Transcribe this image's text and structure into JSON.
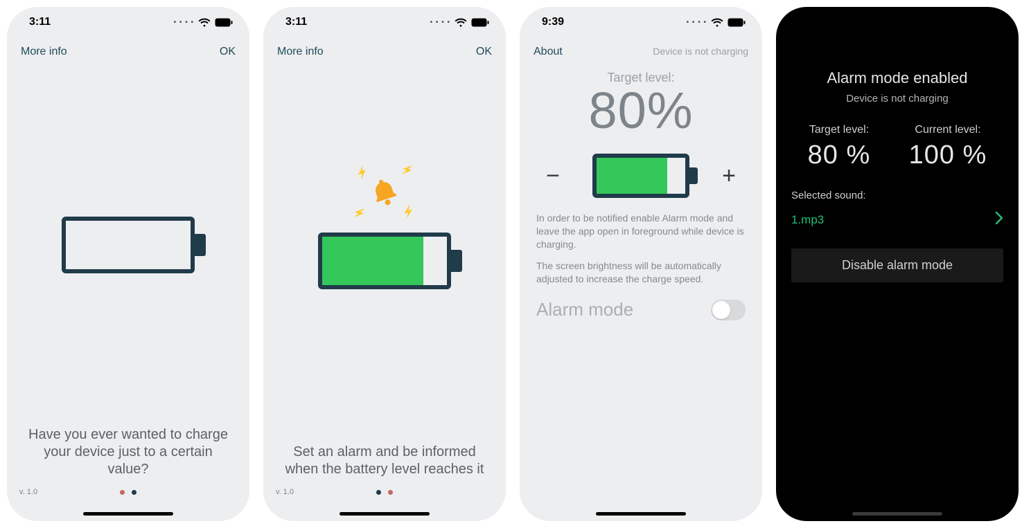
{
  "colors": {
    "outline": "#203b4a",
    "green": "#34c759",
    "accent_green": "#1fbf7a",
    "bell": "#f5a623"
  },
  "screen1": {
    "time": "3:11",
    "nav_left": "More info",
    "nav_right": "OK",
    "caption": "Have you ever wanted to charge your device just to a certain value?",
    "version": "v. 1.0",
    "active_dot": 0
  },
  "screen2": {
    "time": "3:11",
    "nav_left": "More info",
    "nav_right": "OK",
    "caption": "Set an alarm and be informed when the battery level reaches it",
    "version": "v. 1.0",
    "active_dot": 1
  },
  "screen3": {
    "time": "9:39",
    "nav_left": "About",
    "nav_right_status": "Device is not charging",
    "target_label": "Target level:",
    "target_value": "80%",
    "minus": "−",
    "plus": "+",
    "info1": "In order to be notified enable Alarm mode and leave the app open in foreground while device is charging.",
    "info2": "The screen brightness will be automatically adjusted to increase the charge speed.",
    "alarm_label": "Alarm mode",
    "alarm_on": false
  },
  "screen4": {
    "title": "Alarm mode enabled",
    "subtitle": "Device is not charging",
    "target_label": "Target level:",
    "target_value": "80 %",
    "current_label": "Current level:",
    "current_value": "100 %",
    "sound_label": "Selected sound:",
    "sound_name": "1.mp3",
    "disable_label": "Disable alarm mode"
  }
}
